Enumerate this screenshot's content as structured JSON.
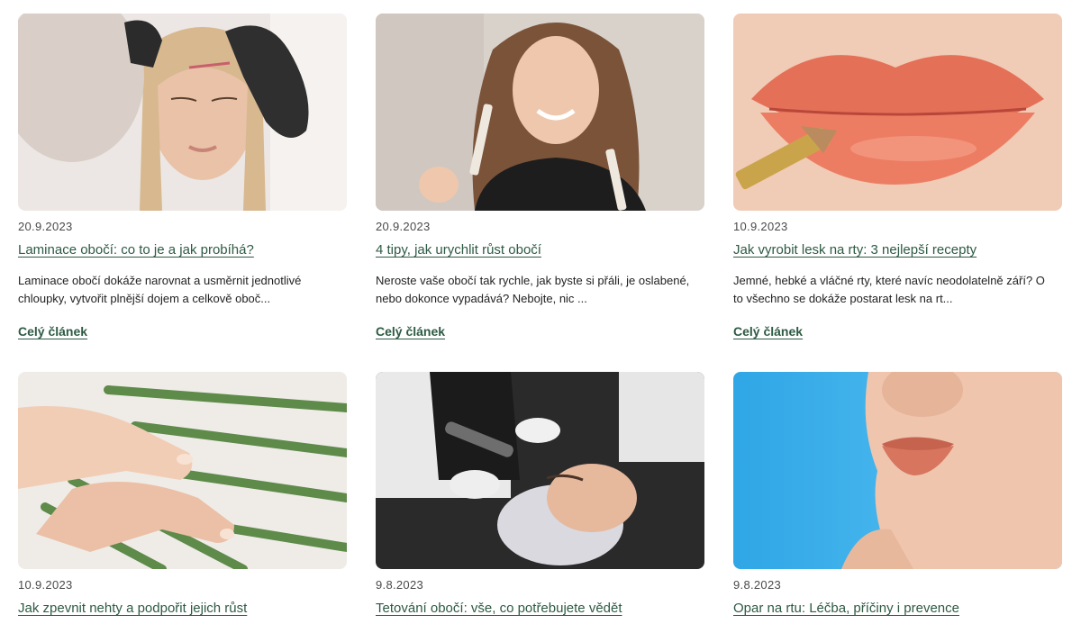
{
  "articles": [
    {
      "image": "eyebrow-lamination-photo",
      "date": "20.9.2023",
      "title": "Laminace obočí: co to je a jak probíhá?",
      "excerpt": "Laminace obočí dokáže narovnat a usměrnit jednotlivé chloupky, vytvořit plnější dojem a celkově oboč...",
      "more": "Celý článek"
    },
    {
      "image": "woman-with-serum-photo",
      "date": "20.9.2023",
      "title": "4 tipy, jak urychlit růst obočí",
      "excerpt": "Neroste vaše obočí tak rychle, jak byste si přáli, je oslabené, nebo dokonce vypadává? Nebojte, nic ...",
      "more": "Celý článek"
    },
    {
      "image": "lip-gloss-brush-photo",
      "date": "10.9.2023",
      "title": "Jak vyrobit lesk na rty: 3 nejlepší recepty",
      "excerpt": "Jemné, hebké a vláčné rty, které navíc neodolatelně září? O to všechno se dokáže postarat lesk na rt...",
      "more": "Celý článek"
    },
    {
      "image": "hands-palm-leaf-photo",
      "date": "10.9.2023",
      "title": "Jak zpevnit nehty a podpořit jejich růst"
    },
    {
      "image": "brow-tattoo-procedure-photo",
      "date": "9.8.2023",
      "title": "Tetování obočí: vše, co potřebujete vědět"
    },
    {
      "image": "lips-blue-background-photo",
      "date": "9.8.2023",
      "title": "Opar na rtu: Léčba, příčiny i prevence"
    }
  ],
  "colors": {
    "link": "#2e5a44",
    "text": "#222222",
    "date": "#4a4a4a"
  }
}
